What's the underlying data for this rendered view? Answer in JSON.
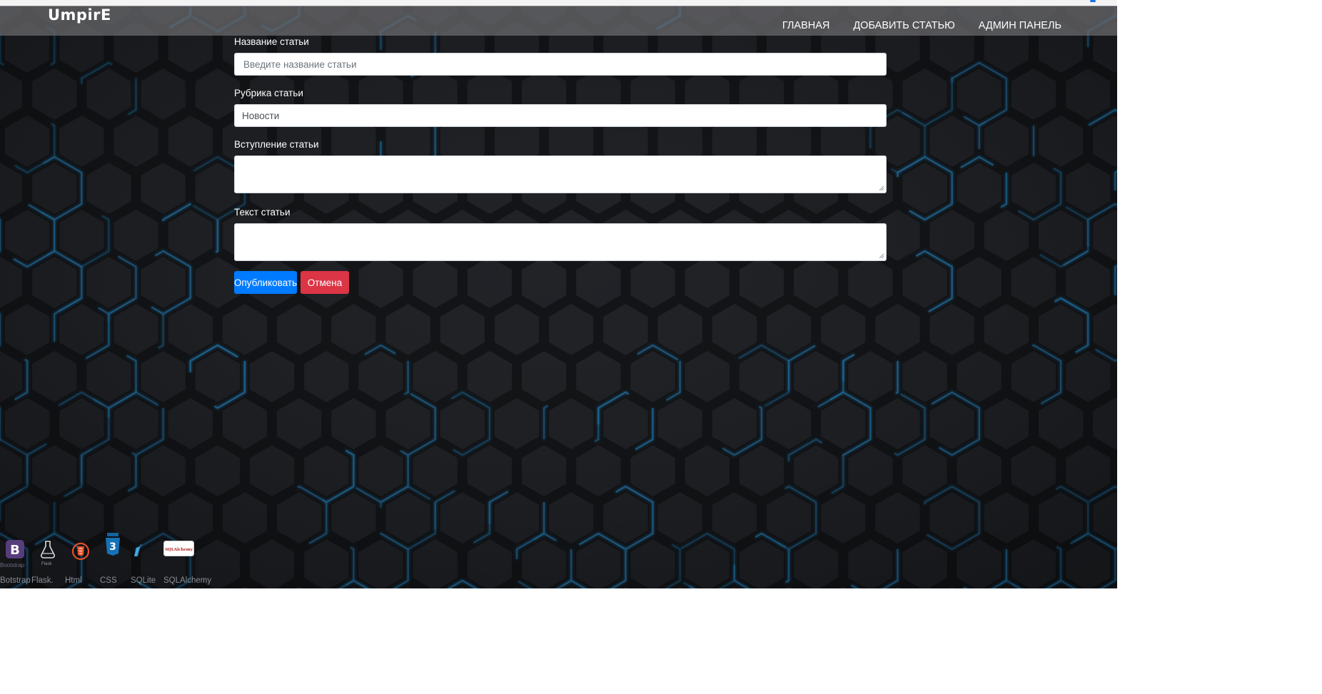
{
  "brand": "UmpirE",
  "nav": {
    "home": "ГЛАВНАЯ",
    "add_article": "ДОБАВИТЬ СТАТЬЮ",
    "admin": "АДМИН ПАНЕЛЬ"
  },
  "form": {
    "title_label": "Название статьи",
    "title_placeholder": "Введите название статьи",
    "title_value": "",
    "rubric_label": "Рубрика статьи",
    "rubric_value": "Новости",
    "intro_label": "Вступление статьи",
    "intro_value": "",
    "text_label": "Текст статьи",
    "text_value": "",
    "publish_button": "Опубликовать",
    "cancel_button": "Отмена"
  },
  "footer": {
    "technologies": [
      {
        "name": "Botstrap",
        "icon": "bootstrap-icon",
        "icon_caption": "Bootstrap",
        "color": "#563d7c"
      },
      {
        "name": "Flask.",
        "icon": "flask-icon",
        "icon_caption": "Flask"
      },
      {
        "name": "Html",
        "icon": "html5-icon",
        "color": "#e34f26"
      },
      {
        "name": "CSS",
        "icon": "css3-icon",
        "color": "#1572b6"
      },
      {
        "name": "SQLite",
        "icon": "sqlite-icon",
        "color": "#44a8e0"
      },
      {
        "name": "SQLAlchemy",
        "icon": "sqlalchemy-icon",
        "icon_caption": "SQLAlchemy"
      }
    ]
  },
  "colors": {
    "background": "#1b1d21",
    "hex_glow": "#1f8fd6",
    "primary": "#007bff",
    "danger": "#dc3545"
  }
}
